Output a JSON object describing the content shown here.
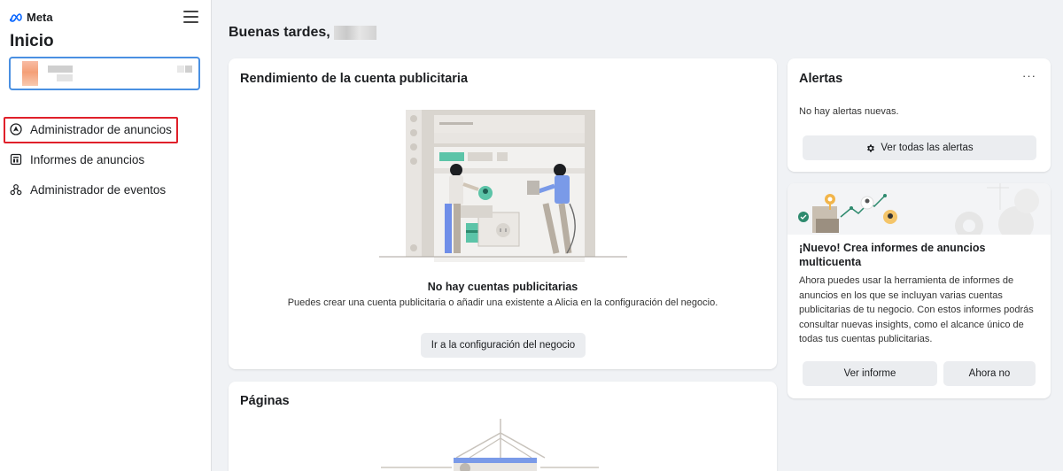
{
  "brand": {
    "logo_text": "Meta"
  },
  "sidebar": {
    "title": "Inicio",
    "items": [
      {
        "label": "Administrador de anuncios",
        "icon": "ads-manager-icon"
      },
      {
        "label": "Informes de anuncios",
        "icon": "reports-icon"
      },
      {
        "label": "Administrador de eventos",
        "icon": "events-manager-icon"
      }
    ]
  },
  "main": {
    "greeting": "Buenas tardes,",
    "performance_card": {
      "title": "Rendimiento de la cuenta publicitaria",
      "empty_title": "No hay cuentas publicitarias",
      "empty_description": "Puedes crear una cuenta publicitaria o añadir una existente a Alicia en la configuración del negocio.",
      "button": "Ir a la configuración del negocio"
    },
    "pages_card": {
      "title": "Páginas"
    }
  },
  "alerts": {
    "title": "Alertas",
    "more": "···",
    "empty_text": "No hay alertas nuevas.",
    "button": "Ver todas las alertas"
  },
  "promo": {
    "title": "¡Nuevo! Crea informes de anuncios multicuenta",
    "description": "Ahora puedes usar la herramienta de informes de anuncios en los que se incluyan varias cuentas publicitarias de tu negocio. Con estos informes podrás consultar nuevas insights, como el alcance único de todas tus cuentas publicitarias.",
    "primary_button": "Ver informe",
    "secondary_button": "Ahora no"
  },
  "colors": {
    "accent_blue": "#4a90e2",
    "highlight_red": "#e0202a",
    "illustration_green": "#5cc4a8",
    "meta_blue": "#0866ff"
  }
}
